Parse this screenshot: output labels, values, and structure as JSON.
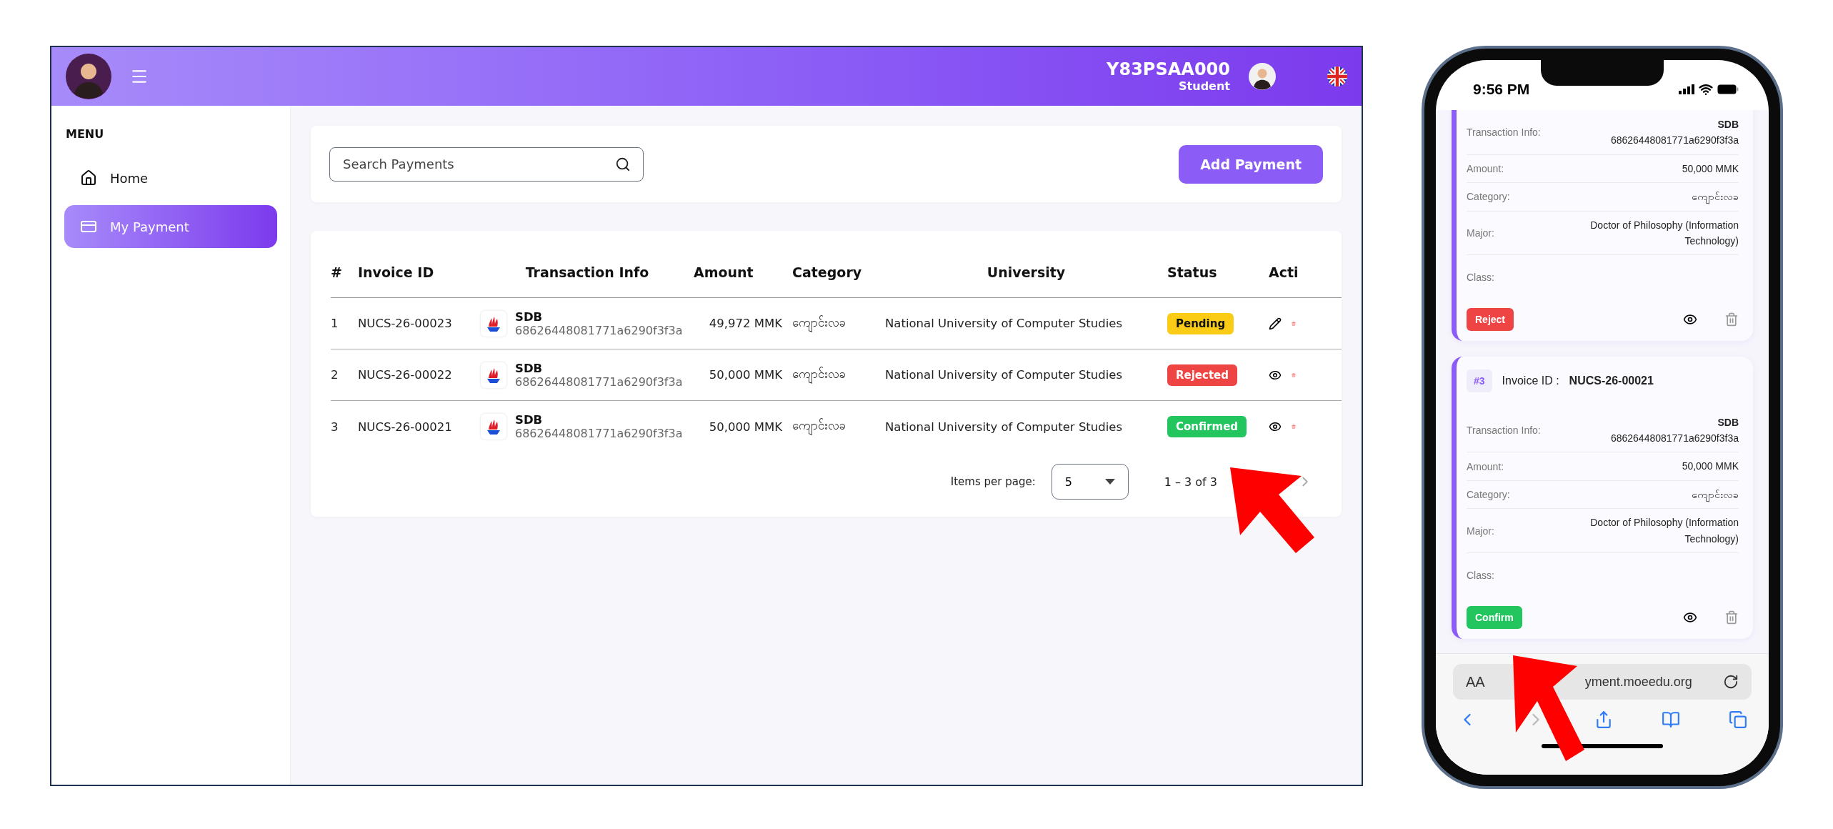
{
  "header": {
    "username": "Y83PSAA000",
    "role": "Student"
  },
  "sidebar": {
    "title": "MENU",
    "items": [
      {
        "label": "Home",
        "selected": false
      },
      {
        "label": "My Payment",
        "selected": true
      }
    ]
  },
  "search": {
    "placeholder": "Search Payments"
  },
  "add_button": "Add Payment",
  "table": {
    "columns": [
      "#",
      "Invoice ID",
      "Transaction Info",
      "Amount",
      "Category",
      "University",
      "Status",
      "Acti"
    ],
    "rows": [
      {
        "number": "1",
        "invoice_id": "NUCS-26-00023",
        "bank": "SDB",
        "transaction_id": "68626448081771a6290f3f3a",
        "amount": "49,972 MMK",
        "category": "ကျောင်းလခ",
        "university": "National University of Computer Studies",
        "status": {
          "label": "Pending",
          "kind": "pending",
          "color": "#facc15"
        },
        "kind": "edit"
      },
      {
        "number": "2",
        "invoice_id": "NUCS-26-00022",
        "bank": "SDB",
        "transaction_id": "68626448081771a6290f3f3a",
        "amount": "50,000 MMK",
        "category": "ကျောင်းလခ",
        "university": "National University of Computer Studies",
        "status": {
          "label": "Rejected",
          "kind": "rejected",
          "color": "#ef4444"
        },
        "kind": "view"
      },
      {
        "number": "3",
        "invoice_id": "NUCS-26-00021",
        "bank": "SDB",
        "transaction_id": "68626448081771a6290f3f3a",
        "amount": "50,000 MMK",
        "category": "ကျောင်းလခ",
        "university": "National University of Computer Studies",
        "status": {
          "label": "Confirmed",
          "kind": "confirmed",
          "color": "#22c55e"
        },
        "kind": "view"
      }
    ]
  },
  "pagination": {
    "label": "Items per page:",
    "page_size": "5",
    "range": "1 – 3 of 3"
  },
  "phone": {
    "time": "9:56 PM",
    "cards": [
      {
        "fields": [
          {
            "label": "Transaction Info:",
            "value": "SDB",
            "detail": "68626448081771a6290f3f3a"
          },
          {
            "label": "Amount:",
            "value": "50,000 MMK"
          },
          {
            "label": "Category:",
            "value": "ကျောင်းလခ"
          },
          {
            "label": "Major:",
            "value": "Doctor of Philosophy (Information Technology)"
          },
          {
            "label": "Class:"
          }
        ],
        "button": {
          "label": "Reject",
          "kind": "reject"
        }
      },
      {
        "index": "#3",
        "invoice_label": "Invoice ID :",
        "invoice_id": "NUCS-26-00021",
        "fields": [
          {
            "label": "Transaction Info:",
            "value": "SDB",
            "detail": "68626448081771a6290f3f3a"
          },
          {
            "label": "Amount:",
            "value": "50,000 MMK"
          },
          {
            "label": "Category:",
            "value": "ကျောင်းလခ"
          },
          {
            "label": "Major:",
            "value": "Doctor of Philosophy (Information Technology)"
          },
          {
            "label": "Class:"
          }
        ],
        "button": {
          "label": "Confirm",
          "kind": "confirm"
        }
      }
    ],
    "text_size": "AA",
    "url": "yment.moeedu.org"
  }
}
